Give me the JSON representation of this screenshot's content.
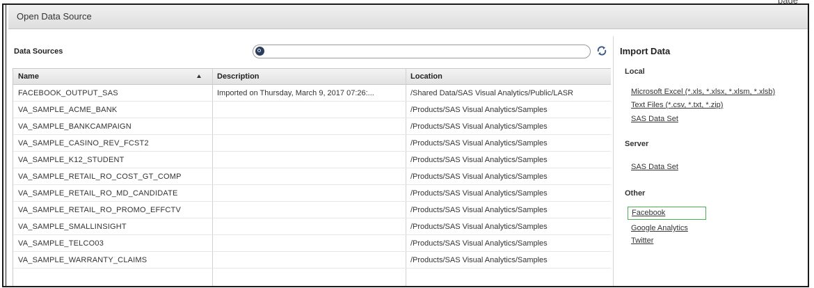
{
  "page_fragment": "page",
  "window": {
    "title": "Open Data Source"
  },
  "data_sources": {
    "label": "Data Sources",
    "search": {
      "placeholder": "",
      "value": ""
    },
    "columns": [
      {
        "label": "Name",
        "sort": "ascending"
      },
      {
        "label": "Description"
      },
      {
        "label": "Location"
      }
    ],
    "rows": [
      {
        "name": "FACEBOOK_OUTPUT_SAS",
        "description": "Imported on Thursday, March 9, 2017 07:26:...",
        "location": "/Shared Data/SAS Visual Analytics/Public/LASR"
      },
      {
        "name": "VA_SAMPLE_ACME_BANK",
        "description": "",
        "location": "/Products/SAS Visual Analytics/Samples"
      },
      {
        "name": "VA_SAMPLE_BANKCAMPAIGN",
        "description": "",
        "location": "/Products/SAS Visual Analytics/Samples"
      },
      {
        "name": "VA_SAMPLE_CASINO_REV_FCST2",
        "description": "",
        "location": "/Products/SAS Visual Analytics/Samples"
      },
      {
        "name": "VA_SAMPLE_K12_STUDENT",
        "description": "",
        "location": "/Products/SAS Visual Analytics/Samples"
      },
      {
        "name": "VA_SAMPLE_RETAIL_RO_COST_GT_COMP",
        "description": "",
        "location": "/Products/SAS Visual Analytics/Samples"
      },
      {
        "name": "VA_SAMPLE_RETAIL_RO_MD_CANDIDATE",
        "description": "",
        "location": "/Products/SAS Visual Analytics/Samples"
      },
      {
        "name": "VA_SAMPLE_RETAIL_RO_PROMO_EFFCTV",
        "description": "",
        "location": "/Products/SAS Visual Analytics/Samples"
      },
      {
        "name": "VA_SAMPLE_SMALLINSIGHT",
        "description": "",
        "location": "/Products/SAS Visual Analytics/Samples"
      },
      {
        "name": "VA_SAMPLE_TELCO03",
        "description": "",
        "location": "/Products/SAS Visual Analytics/Samples"
      },
      {
        "name": "VA_SAMPLE_WARRANTY_CLAIMS",
        "description": "",
        "location": "/Products/SAS Visual Analytics/Samples"
      }
    ]
  },
  "import_data": {
    "title": "Import Data",
    "local": {
      "label": "Local",
      "links": [
        "Microsoft Excel (*.xls, *.xlsx, *.xlsm, *.xlsb)",
        "Text Files (*.csv, *.txt, *.zip)",
        "SAS Data Set"
      ]
    },
    "server": {
      "label": "Server",
      "links": [
        "SAS Data Set"
      ]
    },
    "other": {
      "label": "Other",
      "links": [
        "Facebook",
        "Google Analytics",
        "Twitter"
      ],
      "selected": "Facebook"
    }
  },
  "colors": {
    "title_bar": "#e6e6e6",
    "selection_border": "#4caf50",
    "search_icon": "#2c3e5a",
    "refresh_icon": "#3a5a8a"
  },
  "icons": {
    "search": "search-icon",
    "refresh": "refresh-icon",
    "sort": "sort-ascending-icon"
  }
}
